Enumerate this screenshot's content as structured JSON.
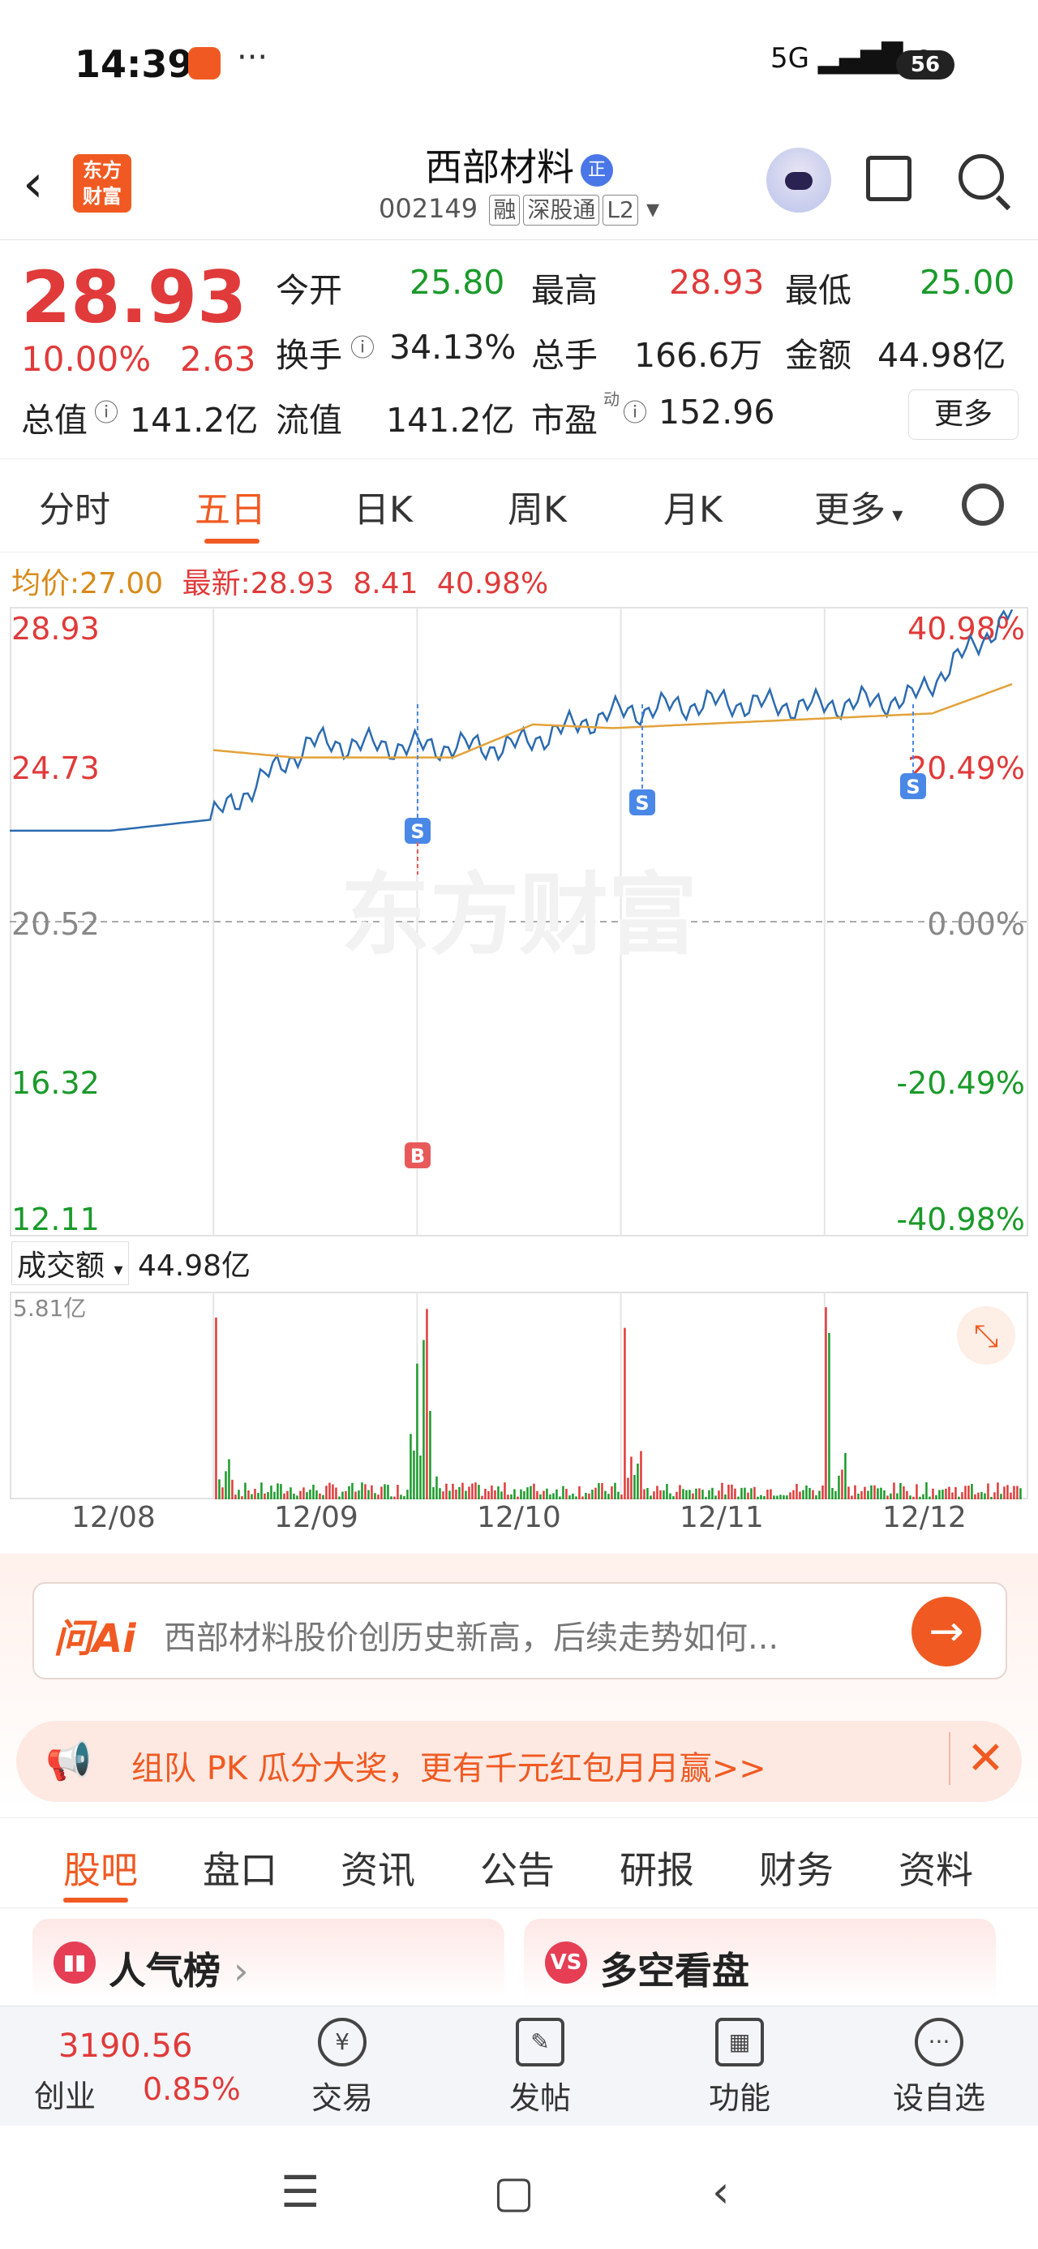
{
  "status_bar": {
    "time": "14:39",
    "dots": "···",
    "network": "5G",
    "battery": "56"
  },
  "header": {
    "back_icon": "chevron-left-icon",
    "logo_line1": "东方",
    "logo_line2": "财富",
    "stock_name": "西部材料",
    "badge": "正",
    "code": "002149",
    "tags": [
      "融",
      "深股通",
      "L2"
    ]
  },
  "quote": {
    "price": "28.93",
    "change_pct": "10.00%",
    "change": "2.63",
    "open_label": "今开",
    "open": "25.80",
    "high_label": "最高",
    "high": "28.93",
    "low_label": "最低",
    "low": "25.00",
    "turnover_label": "换手",
    "turnover": "34.13%",
    "volume_label": "总手",
    "volume": "166.6万",
    "amount_label": "金额",
    "amount": "44.98亿",
    "mcap_label": "总值",
    "mcap": "141.2亿",
    "float_label": "流值",
    "float": "141.2亿",
    "pe_label": "市盈",
    "pe_sup": "动",
    "pe": "152.96",
    "more": "更多"
  },
  "tabs": [
    "分时",
    "五日",
    "日K",
    "周K",
    "月K",
    "更多"
  ],
  "chart_info": {
    "avg_label": "均价:",
    "avg": "27.00",
    "latest_label": "最新:",
    "latest": "28.93",
    "chg": "8.41",
    "pct": "40.98%"
  },
  "chart_data": {
    "type": "line",
    "left_ticks": [
      "28.93",
      "24.73",
      "20.52",
      "16.32",
      "12.11"
    ],
    "right_ticks": [
      "40.98%",
      "20.49%",
      "0.00%",
      "-20.49%",
      "-40.98%"
    ],
    "ylim": [
      12.11,
      28.93
    ],
    "x": [
      "12/08",
      "12/09",
      "12/10",
      "12/11",
      "12/12"
    ],
    "series": [
      {
        "values": [
          23.0,
          23.0,
          23.3,
          25.4,
          25.3,
          25.3,
          26.2,
          26.5,
          26.4,
          26.6,
          28.93
        ]
      },
      {
        "values": [
          25.2,
          25.0,
          25.0,
          25.0,
          25.9,
          25.8,
          25.9,
          26.0,
          26.1,
          26.2,
          27.0
        ]
      }
    ],
    "markers": [
      "S",
      "B",
      "S",
      "S"
    ],
    "watermark": "东方财富"
  },
  "volume": {
    "label": "成交额",
    "total": "44.98亿",
    "max_label": "5.81亿",
    "expand_icon": "expand-icon"
  },
  "ai": {
    "logo": "问Ai",
    "prompt": "西部材料股价创历史新高，后续走势如何...",
    "go_icon": "arrow-right-icon"
  },
  "promo": {
    "text": "组队 PK 瓜分大奖，更有千元红包月月赢>>",
    "close": "✕"
  },
  "sub_tabs": [
    "股吧",
    "盘口",
    "资讯",
    "公告",
    "研报",
    "财务",
    "资料"
  ],
  "cards": [
    {
      "label": "人气榜",
      "icon": "chart-bar-icon"
    },
    {
      "label": "多空看盘",
      "icon": "vs-icon"
    }
  ],
  "bottom_bar": {
    "index_value": "3190.56",
    "index_name": "创业",
    "index_pct": "0.85%",
    "items": [
      "交易",
      "发帖",
      "功能",
      "设自选"
    ]
  }
}
